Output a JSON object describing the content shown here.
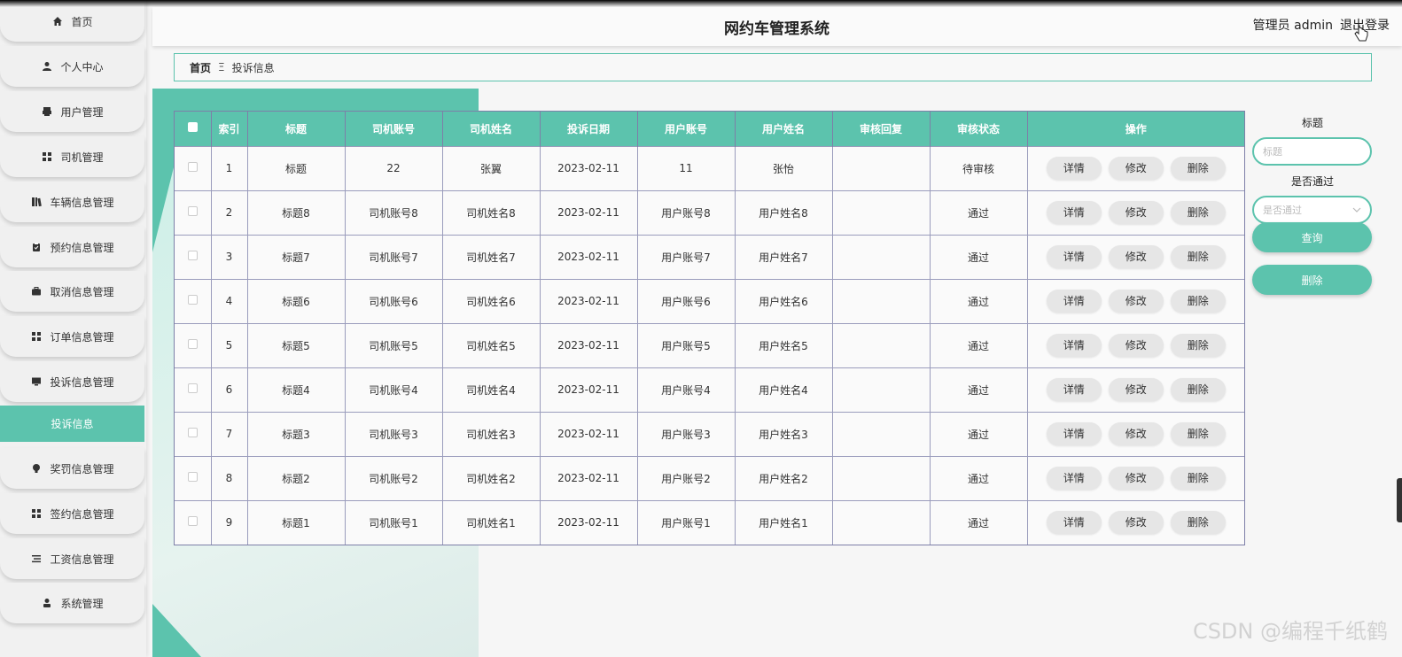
{
  "app": {
    "title": "网约车管理系统"
  },
  "header": {
    "user_label": "管理员 admin",
    "logout_label": "退出登录"
  },
  "breadcrumb": {
    "home": "首页",
    "separator": "Ξ",
    "current": "投诉信息"
  },
  "sidebar": {
    "items": [
      {
        "label": "首页",
        "icon": "home-icon"
      },
      {
        "label": "个人中心",
        "icon": "user-icon"
      },
      {
        "label": "用户管理",
        "icon": "printer-icon"
      },
      {
        "label": "司机管理",
        "icon": "grid-icon"
      },
      {
        "label": "车辆信息管理",
        "icon": "book-icon"
      },
      {
        "label": "预约信息管理",
        "icon": "clipboard-icon"
      },
      {
        "label": "取消信息管理",
        "icon": "briefcase-icon"
      },
      {
        "label": "订单信息管理",
        "icon": "grid-icon"
      },
      {
        "label": "投诉信息管理",
        "icon": "monitor-icon"
      },
      {
        "label": "投诉信息",
        "icon": ""
      },
      {
        "label": "奖罚信息管理",
        "icon": "bulb-icon"
      },
      {
        "label": "签约信息管理",
        "icon": "grid-icon"
      },
      {
        "label": "工资信息管理",
        "icon": "list-icon"
      },
      {
        "label": "系统管理",
        "icon": "person-icon"
      }
    ]
  },
  "table": {
    "columns": [
      "索引",
      "标题",
      "司机账号",
      "司机姓名",
      "投诉日期",
      "用户账号",
      "用户姓名",
      "审核回复",
      "审核状态",
      "操作"
    ],
    "rows": [
      [
        "1",
        "标题",
        "22",
        "张翼",
        "2023-02-11",
        "11",
        "张怡",
        "",
        "待审核"
      ],
      [
        "2",
        "标题8",
        "司机账号8",
        "司机姓名8",
        "2023-02-11",
        "用户账号8",
        "用户姓名8",
        "",
        "通过"
      ],
      [
        "3",
        "标题7",
        "司机账号7",
        "司机姓名7",
        "2023-02-11",
        "用户账号7",
        "用户姓名7",
        "",
        "通过"
      ],
      [
        "4",
        "标题6",
        "司机账号6",
        "司机姓名6",
        "2023-02-11",
        "用户账号6",
        "用户姓名6",
        "",
        "通过"
      ],
      [
        "5",
        "标题5",
        "司机账号5",
        "司机姓名5",
        "2023-02-11",
        "用户账号5",
        "用户姓名5",
        "",
        "通过"
      ],
      [
        "6",
        "标题4",
        "司机账号4",
        "司机姓名4",
        "2023-02-11",
        "用户账号4",
        "用户姓名4",
        "",
        "通过"
      ],
      [
        "7",
        "标题3",
        "司机账号3",
        "司机姓名3",
        "2023-02-11",
        "用户账号3",
        "用户姓名3",
        "",
        "通过"
      ],
      [
        "8",
        "标题2",
        "司机账号2",
        "司机姓名2",
        "2023-02-11",
        "用户账号2",
        "用户姓名2",
        "",
        "通过"
      ],
      [
        "9",
        "标题1",
        "司机账号1",
        "司机姓名1",
        "2023-02-11",
        "用户账号1",
        "用户姓名1",
        "",
        "通过"
      ]
    ],
    "actions": {
      "detail": "详情",
      "edit": "修改",
      "delete": "删除"
    }
  },
  "search": {
    "title_label": "标题",
    "title_placeholder": "标题",
    "pass_label": "是否通过",
    "pass_placeholder": "是否通过",
    "query_button": "查询",
    "delete_button": "删除"
  },
  "watermark": "CSDN @编程千纸鹤",
  "colors": {
    "accent": "#5cc3ad"
  }
}
